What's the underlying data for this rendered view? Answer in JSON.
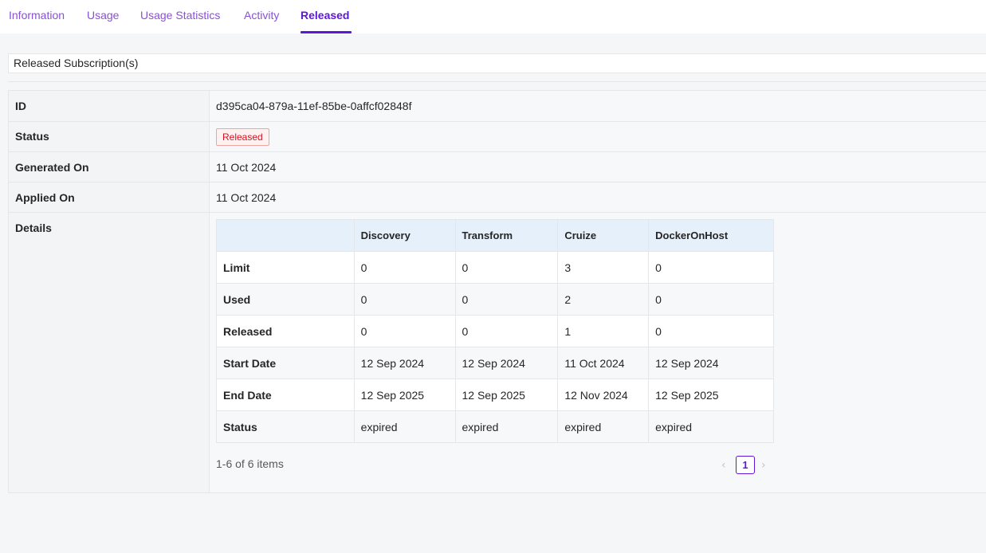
{
  "tabs": [
    "Information",
    "Usage",
    "Usage Statistics",
    "Activity",
    "Released"
  ],
  "active_tab": "Released",
  "section_title": "Released Subscription(s)",
  "fields": {
    "id": {
      "label": "ID",
      "value": "d395ca04-879a-11ef-85be-0affcf02848f"
    },
    "status": {
      "label": "Status",
      "value": "Released"
    },
    "generated_on": {
      "label": "Generated On",
      "value": "11 Oct 2024"
    },
    "applied_on": {
      "label": "Applied On",
      "value": "11 Oct 2024"
    },
    "details": {
      "label": "Details"
    }
  },
  "details_table": {
    "columns": [
      "",
      "Discovery",
      "Transform",
      "Cruize",
      "DockerOnHost"
    ],
    "rows": [
      [
        "Limit",
        "0",
        "0",
        "3",
        "0"
      ],
      [
        "Used",
        "0",
        "0",
        "2",
        "0"
      ],
      [
        "Released",
        "0",
        "0",
        "1",
        "0"
      ],
      [
        "Start Date",
        "12 Sep 2024",
        "12 Sep 2024",
        "11 Oct 2024",
        "12 Sep 2024"
      ],
      [
        "End Date",
        "12 Sep 2025",
        "12 Sep 2025",
        "12 Nov 2024",
        "12 Sep 2025"
      ],
      [
        "Status",
        "expired",
        "expired",
        "expired",
        "expired"
      ]
    ]
  },
  "pagination": {
    "summary": "1-6 of 6 items",
    "current_page": "1",
    "prev_icon": "chevron-left-icon",
    "next_icon": "chevron-right-icon"
  },
  "colors": {
    "accent": "#5d17d6",
    "tab_text": "#8a4fd8",
    "released_badge": "#cf1322"
  }
}
